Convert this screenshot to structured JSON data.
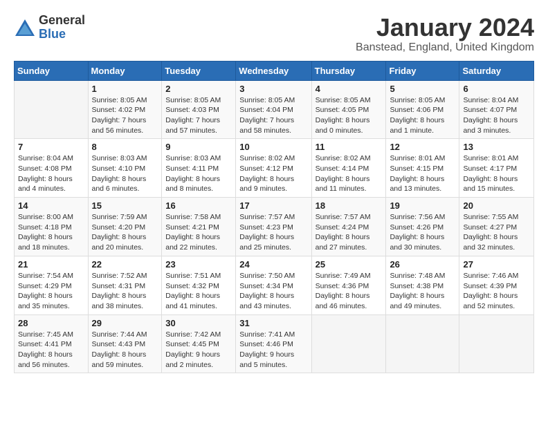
{
  "header": {
    "logo_line1": "General",
    "logo_line2": "Blue",
    "month_year": "January 2024",
    "location": "Banstead, England, United Kingdom"
  },
  "days_of_week": [
    "Sunday",
    "Monday",
    "Tuesday",
    "Wednesday",
    "Thursday",
    "Friday",
    "Saturday"
  ],
  "weeks": [
    [
      {
        "day": "",
        "info": ""
      },
      {
        "day": "1",
        "info": "Sunrise: 8:05 AM\nSunset: 4:02 PM\nDaylight: 7 hours\nand 56 minutes."
      },
      {
        "day": "2",
        "info": "Sunrise: 8:05 AM\nSunset: 4:03 PM\nDaylight: 7 hours\nand 57 minutes."
      },
      {
        "day": "3",
        "info": "Sunrise: 8:05 AM\nSunset: 4:04 PM\nDaylight: 7 hours\nand 58 minutes."
      },
      {
        "day": "4",
        "info": "Sunrise: 8:05 AM\nSunset: 4:05 PM\nDaylight: 8 hours\nand 0 minutes."
      },
      {
        "day": "5",
        "info": "Sunrise: 8:05 AM\nSunset: 4:06 PM\nDaylight: 8 hours\nand 1 minute."
      },
      {
        "day": "6",
        "info": "Sunrise: 8:04 AM\nSunset: 4:07 PM\nDaylight: 8 hours\nand 3 minutes."
      }
    ],
    [
      {
        "day": "7",
        "info": "Sunrise: 8:04 AM\nSunset: 4:08 PM\nDaylight: 8 hours\nand 4 minutes."
      },
      {
        "day": "8",
        "info": "Sunrise: 8:03 AM\nSunset: 4:10 PM\nDaylight: 8 hours\nand 6 minutes."
      },
      {
        "day": "9",
        "info": "Sunrise: 8:03 AM\nSunset: 4:11 PM\nDaylight: 8 hours\nand 8 minutes."
      },
      {
        "day": "10",
        "info": "Sunrise: 8:02 AM\nSunset: 4:12 PM\nDaylight: 8 hours\nand 9 minutes."
      },
      {
        "day": "11",
        "info": "Sunrise: 8:02 AM\nSunset: 4:14 PM\nDaylight: 8 hours\nand 11 minutes."
      },
      {
        "day": "12",
        "info": "Sunrise: 8:01 AM\nSunset: 4:15 PM\nDaylight: 8 hours\nand 13 minutes."
      },
      {
        "day": "13",
        "info": "Sunrise: 8:01 AM\nSunset: 4:17 PM\nDaylight: 8 hours\nand 15 minutes."
      }
    ],
    [
      {
        "day": "14",
        "info": "Sunrise: 8:00 AM\nSunset: 4:18 PM\nDaylight: 8 hours\nand 18 minutes."
      },
      {
        "day": "15",
        "info": "Sunrise: 7:59 AM\nSunset: 4:20 PM\nDaylight: 8 hours\nand 20 minutes."
      },
      {
        "day": "16",
        "info": "Sunrise: 7:58 AM\nSunset: 4:21 PM\nDaylight: 8 hours\nand 22 minutes."
      },
      {
        "day": "17",
        "info": "Sunrise: 7:57 AM\nSunset: 4:23 PM\nDaylight: 8 hours\nand 25 minutes."
      },
      {
        "day": "18",
        "info": "Sunrise: 7:57 AM\nSunset: 4:24 PM\nDaylight: 8 hours\nand 27 minutes."
      },
      {
        "day": "19",
        "info": "Sunrise: 7:56 AM\nSunset: 4:26 PM\nDaylight: 8 hours\nand 30 minutes."
      },
      {
        "day": "20",
        "info": "Sunrise: 7:55 AM\nSunset: 4:27 PM\nDaylight: 8 hours\nand 32 minutes."
      }
    ],
    [
      {
        "day": "21",
        "info": "Sunrise: 7:54 AM\nSunset: 4:29 PM\nDaylight: 8 hours\nand 35 minutes."
      },
      {
        "day": "22",
        "info": "Sunrise: 7:52 AM\nSunset: 4:31 PM\nDaylight: 8 hours\nand 38 minutes."
      },
      {
        "day": "23",
        "info": "Sunrise: 7:51 AM\nSunset: 4:32 PM\nDaylight: 8 hours\nand 41 minutes."
      },
      {
        "day": "24",
        "info": "Sunrise: 7:50 AM\nSunset: 4:34 PM\nDaylight: 8 hours\nand 43 minutes."
      },
      {
        "day": "25",
        "info": "Sunrise: 7:49 AM\nSunset: 4:36 PM\nDaylight: 8 hours\nand 46 minutes."
      },
      {
        "day": "26",
        "info": "Sunrise: 7:48 AM\nSunset: 4:38 PM\nDaylight: 8 hours\nand 49 minutes."
      },
      {
        "day": "27",
        "info": "Sunrise: 7:46 AM\nSunset: 4:39 PM\nDaylight: 8 hours\nand 52 minutes."
      }
    ],
    [
      {
        "day": "28",
        "info": "Sunrise: 7:45 AM\nSunset: 4:41 PM\nDaylight: 8 hours\nand 56 minutes."
      },
      {
        "day": "29",
        "info": "Sunrise: 7:44 AM\nSunset: 4:43 PM\nDaylight: 8 hours\nand 59 minutes."
      },
      {
        "day": "30",
        "info": "Sunrise: 7:42 AM\nSunset: 4:45 PM\nDaylight: 9 hours\nand 2 minutes."
      },
      {
        "day": "31",
        "info": "Sunrise: 7:41 AM\nSunset: 4:46 PM\nDaylight: 9 hours\nand 5 minutes."
      },
      {
        "day": "",
        "info": ""
      },
      {
        "day": "",
        "info": ""
      },
      {
        "day": "",
        "info": ""
      }
    ]
  ]
}
